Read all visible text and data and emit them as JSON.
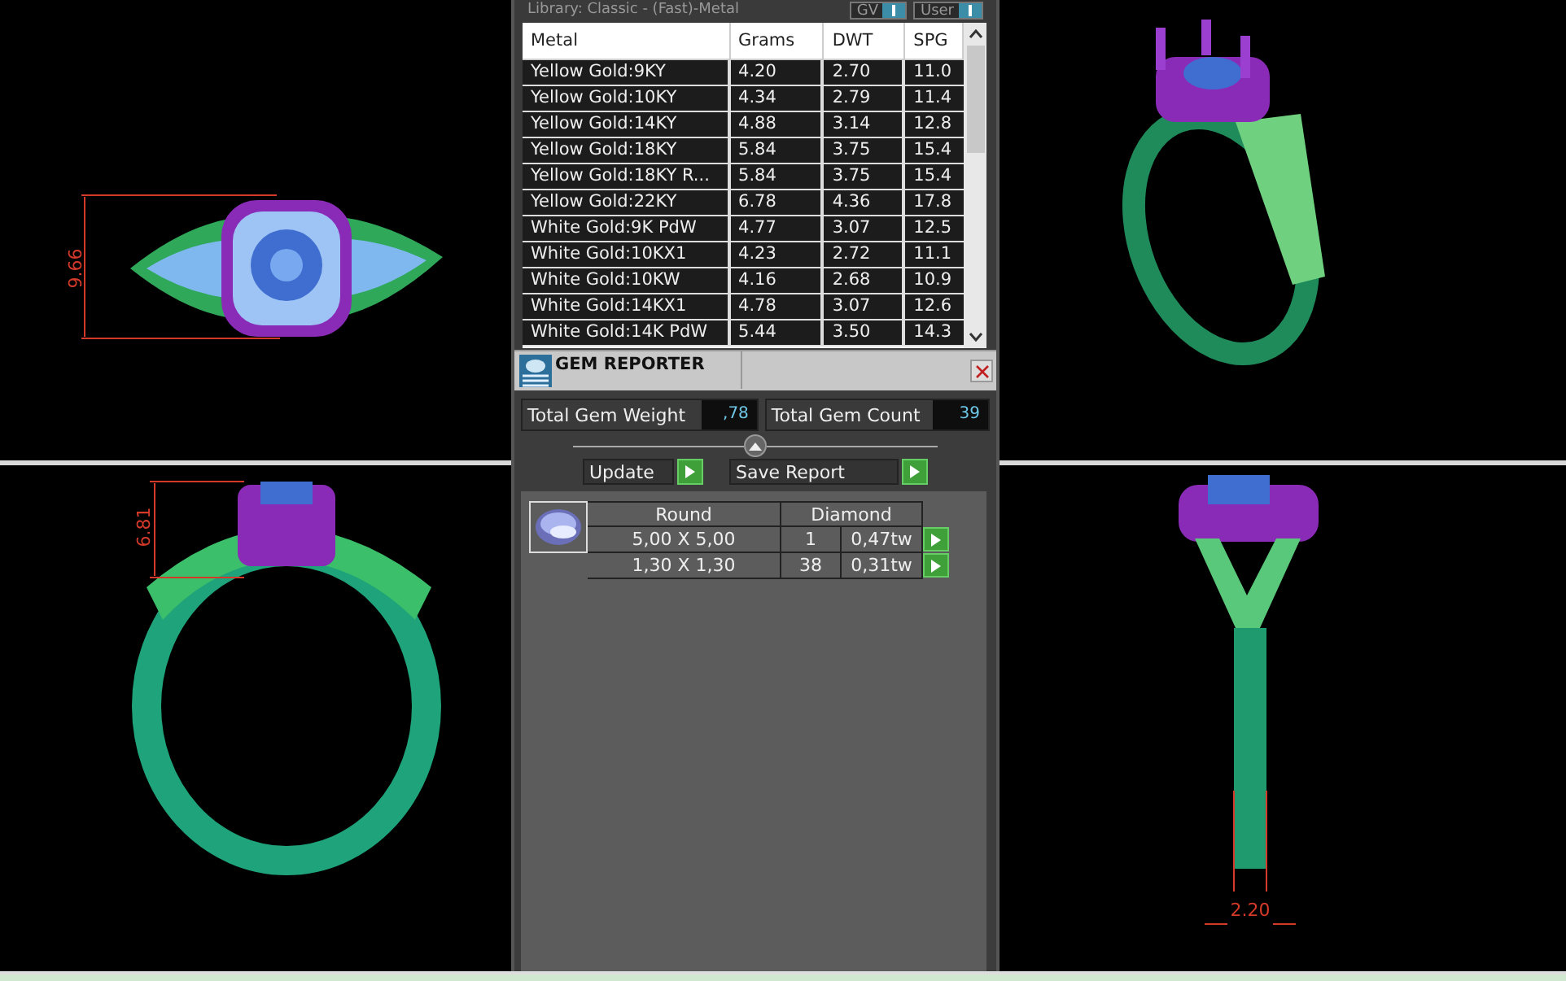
{
  "library_label": "Library: Classic - (Fast)-Metal",
  "view_buttons": [
    {
      "label": "GV"
    },
    {
      "label": "User"
    }
  ],
  "metal_table": {
    "columns": [
      "Metal",
      "Grams",
      "DWT",
      "SPG"
    ],
    "rows": [
      [
        "Yellow Gold:9KY",
        "4.20",
        "2.70",
        "11.0"
      ],
      [
        "Yellow Gold:10KY",
        "4.34",
        "2.79",
        "11.4"
      ],
      [
        "Yellow Gold:14KY",
        "4.88",
        "3.14",
        "12.8"
      ],
      [
        "Yellow Gold:18KY",
        "5.84",
        "3.75",
        "15.4"
      ],
      [
        "Yellow Gold:18KY R...",
        "5.84",
        "3.75",
        "15.4"
      ],
      [
        "Yellow Gold:22KY",
        "6.78",
        "4.36",
        "17.8"
      ],
      [
        "White Gold:9K PdW",
        "4.77",
        "3.07",
        "12.5"
      ],
      [
        "White Gold:10KX1",
        "4.23",
        "2.72",
        "11.1"
      ],
      [
        "White Gold:10KW",
        "4.16",
        "2.68",
        "10.9"
      ],
      [
        "White Gold:14KX1",
        "4.78",
        "3.07",
        "12.6"
      ],
      [
        "White Gold:14K PdW",
        "5.44",
        "3.50",
        "14.3"
      ]
    ]
  },
  "gem_reporter": {
    "title": "GEM REPORTER",
    "total_weight": {
      "label": "Total Gem Weight",
      "value": ",78"
    },
    "total_count": {
      "label": "Total Gem Count",
      "value": "39"
    },
    "buttons": [
      "Update",
      "Save Report"
    ],
    "gems": {
      "shape": "Round",
      "type": "Diamond",
      "rows": [
        {
          "size": "5,00 X 5,00",
          "count": "1",
          "weight": "0,47tw"
        },
        {
          "size": "1,30 X 1,30",
          "count": "38",
          "weight": "0,31tw"
        }
      ]
    }
  },
  "viewports": [
    {
      "kind": "top",
      "dimension": "9.66"
    },
    {
      "kind": "iso"
    },
    {
      "kind": "front",
      "dimension": "6.81"
    },
    {
      "kind": "side",
      "dimension": "2.20"
    }
  ]
}
